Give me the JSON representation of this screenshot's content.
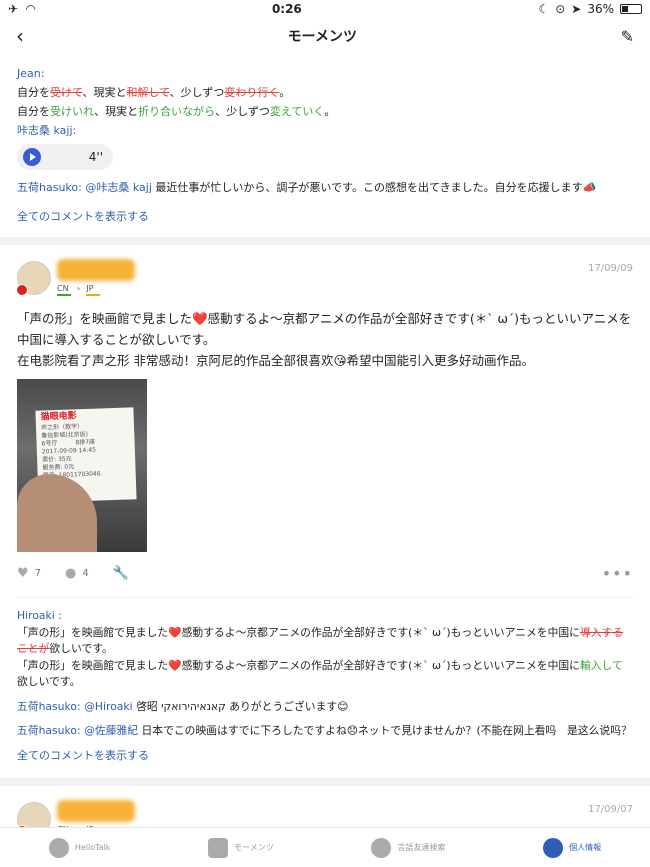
{
  "status": {
    "time": "0:26",
    "battery": "36%",
    "battery_level": 0.36
  },
  "nav": {
    "title": "モーメンツ"
  },
  "top_comments": {
    "jean_name": "Jean:",
    "jean_line1": {
      "a": "自分を",
      "b": "受けて",
      "c": "、現実と",
      "d": "和解して",
      "e": "、少しずつ",
      "f": "変わり行く",
      "g": "。"
    },
    "jean_line2": {
      "a": "自分を",
      "b": "受けいれ",
      "c": "、現実と",
      "d": "折り合いながら",
      "e": "、少しずつ",
      "f": "変えていく",
      "g": "。"
    },
    "voice_name": "咔志桑 kajj:",
    "voice_length": "4''",
    "reply_name": "五荷hasuko:",
    "reply_mention": "@咔志桑 kajj",
    "reply_text": "最近仕事が忙しいから、調子が悪いです。この感想を出てきました。自分を応援します📣",
    "show_all": "全てのコメントを表示する"
  },
  "post": {
    "langs": [
      "CN",
      "JP"
    ],
    "date": "17/09/09",
    "body_jp1": "「声の形」を映画館で見ました",
    "body_jp2": "感動するよ〜京都アニメの作品が全部好きです(＊ˋ ω´)もっといいアニメを中国に導入することが欲しいです。",
    "body_cn1": "在电影院看了声之形 非常感动！京阿尼的作品全部很喜欢",
    "body_cn2": "希望中国能引入更多好动画作品。",
    "photo_ticket_title": "猫眼电影",
    "likes": "7",
    "comments": "4",
    "c1_name": "Hiroaki :",
    "c1_l1a": "「声の形」を映画館で見ました",
    "c1_l1b": "感動するよ〜京都アニメの作品が全部好きです(＊ˋ ω´)もっといいアニメを中国に",
    "c1_l1c": "導入することが",
    "c1_l1d": "欲しいです。",
    "c1_l2a": "「声の形」を映画館で見ました",
    "c1_l2b": "感動するよ〜京都アニメの作品が全部好きです(＊ˋ ω´)もっといいアニメを中国に",
    "c1_l2c": "輸入して",
    "c1_l2d": "欲しいです。",
    "c2_name": "五荷hasuko:",
    "c2_mention": "@Hiroaki",
    "c2_text": "啓昭 קאנאיהירואקי ありがとうございます😊",
    "c3_name": "五荷hasuko:",
    "c3_mention": "@佐藤雅紀",
    "c3_text": "日本でこの映画はすでに下ろしたですよね😞ネットで見けませんか？(不能在网上看吗　是这么说吗？",
    "show_all": "全てのコメントを表示する"
  },
  "post2": {
    "langs": [
      "CN",
      "JP"
    ],
    "date": "17/09/07"
  },
  "tabs": [
    {
      "label": "HelloTalk",
      "icon": "chat-icon"
    },
    {
      "label": "モーメンツ",
      "icon": "moments-icon"
    },
    {
      "label": "言語友達検索",
      "icon": "search-icon"
    },
    {
      "label": "個人情報",
      "icon": "profile-icon"
    }
  ]
}
